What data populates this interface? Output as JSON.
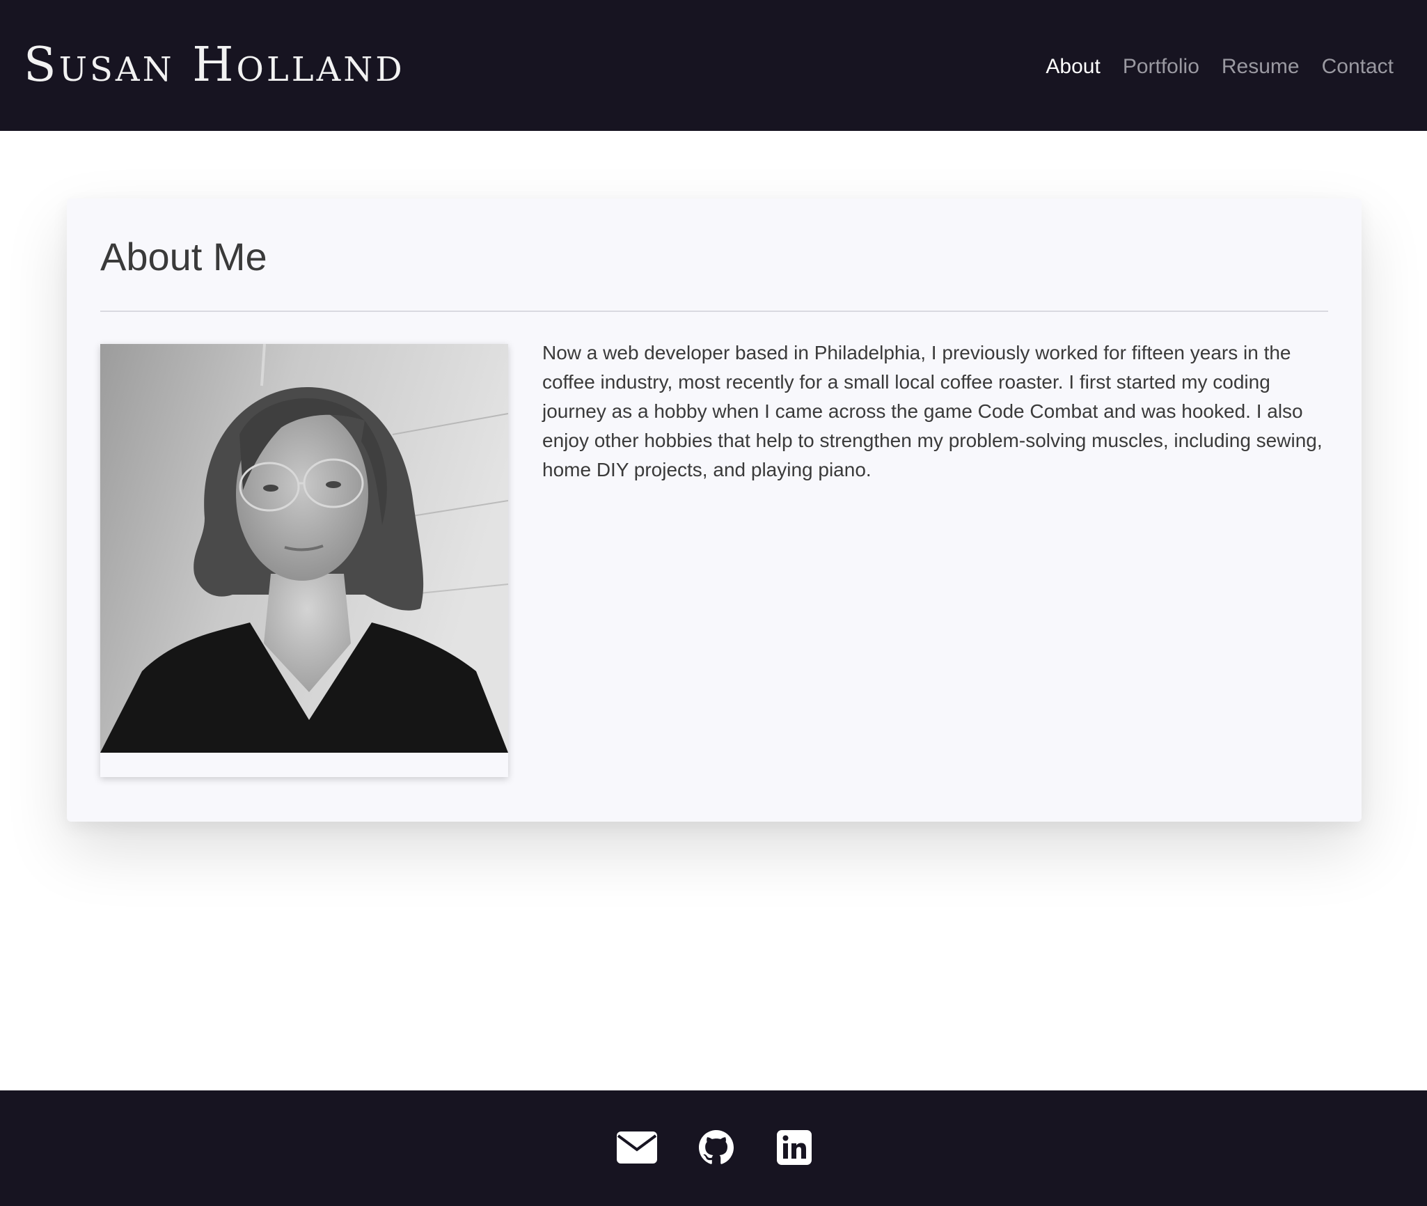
{
  "header": {
    "brand": "Susan Holland",
    "nav": [
      {
        "label": "About",
        "active": true
      },
      {
        "label": "Portfolio",
        "active": false
      },
      {
        "label": "Resume",
        "active": false
      },
      {
        "label": "Contact",
        "active": false
      }
    ]
  },
  "about": {
    "title": "About Me",
    "photo_alt": "Portrait of Susan Holland",
    "text": "Now a web developer based in Philadelphia, I previously worked for fifteen years in the coffee industry, most recently for a small local coffee roaster. I first started my coding journey as a hobby when I came across the game Code Combat and was hooked. I also enjoy other hobbies that help to strengthen my problem-solving muscles, including sewing, home DIY projects, and playing piano."
  },
  "footer": {
    "social": [
      {
        "icon": "envelope-icon",
        "label": "Email"
      },
      {
        "icon": "github-icon",
        "label": "GitHub"
      },
      {
        "icon": "linkedin-icon",
        "label": "LinkedIn"
      }
    ]
  },
  "colors": {
    "navbar_bg": "#171421",
    "card_bg": "#f8f8fc",
    "text": "#3a3a3a",
    "nav_inactive": "#9a99a1",
    "nav_active": "#ffffff"
  }
}
